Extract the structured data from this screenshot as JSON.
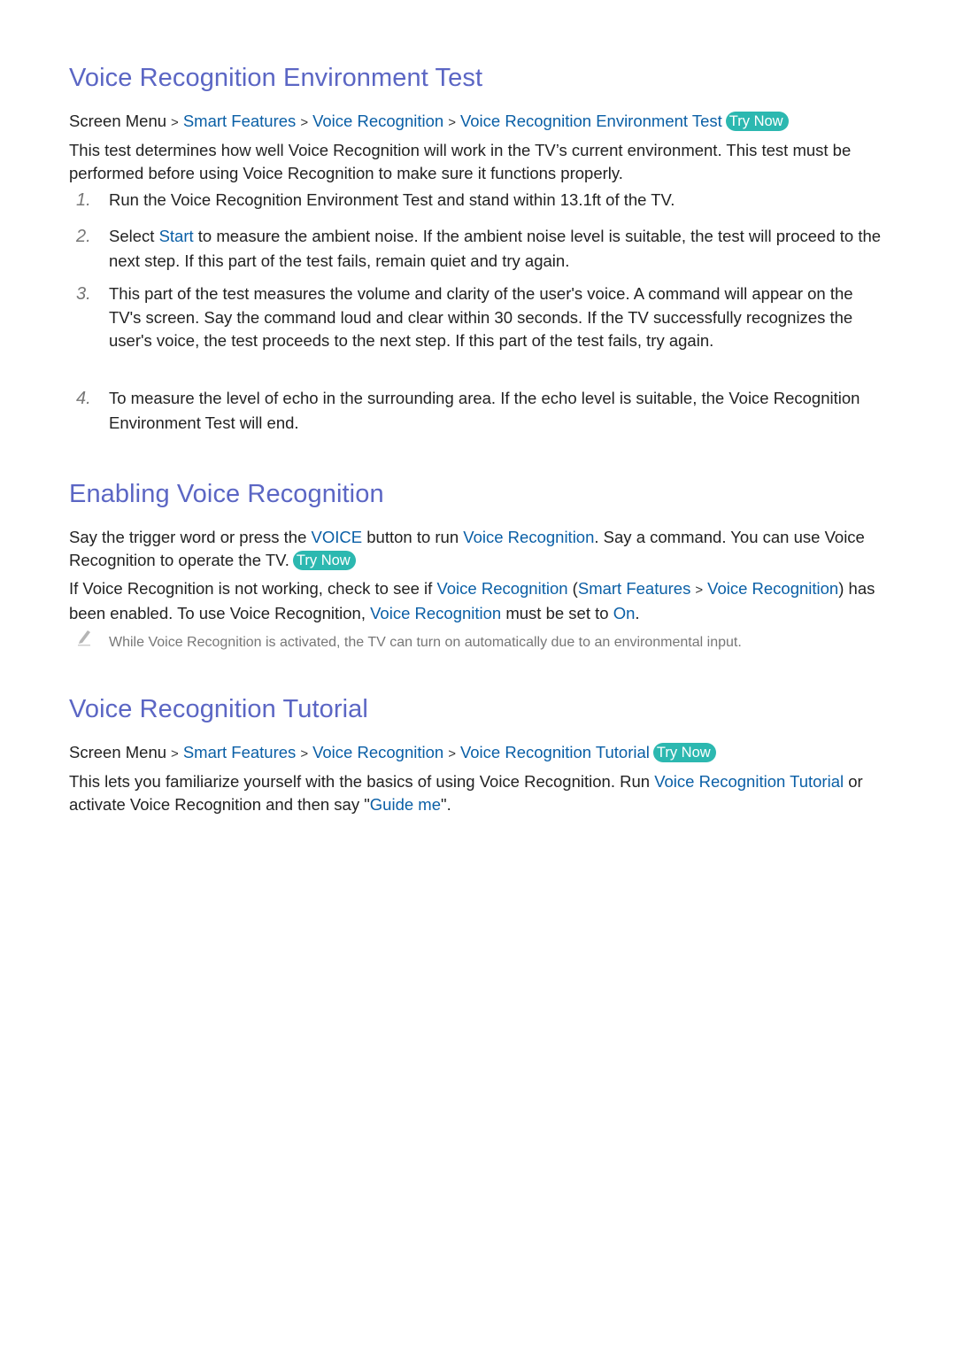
{
  "sections": [
    {
      "title": "Voice Recognition Environment Test",
      "breadcrumb": {
        "root": "Screen Menu",
        "items": [
          "Smart Features",
          "Voice Recognition",
          "Voice Recognition Environment Test"
        ],
        "try_now": "Try Now"
      },
      "intro": "This test determines how well Voice Recognition will work in the TV’s current environment. This test must be performed before using Voice Recognition to make sure it functions properly.",
      "steps": [
        {
          "num": "1.",
          "text": "Run the Voice Recognition Environment Test and stand within 13.1ft of the TV."
        },
        {
          "num": "2.",
          "pre": "Select ",
          "link": "Start",
          "post": " to measure the ambient noise. If the ambient noise level is suitable, the test will proceed to the next step. If this part of the test fails, remain quiet and try again."
        },
        {
          "num": "3.",
          "text": "This part of the test measures the volume and clarity of the user's voice. A command will appear on the TV's screen. Say the command loud and clear within 30 seconds. If the TV successfully recognizes the user's voice, the test proceeds to the next step. If this part of the test fails, try again."
        },
        {
          "num": "4.",
          "text": "To measure the level of echo in the surrounding area. If the echo level is suitable, the Voice Recognition Environment Test will end."
        }
      ]
    },
    {
      "title": "Enabling Voice Recognition",
      "p1": {
        "a": "Say the trigger word or press the ",
        "voice": "VOICE",
        "b": " button to run ",
        "link": "Voice Recognition",
        "c": ". Say a command. You can use Voice Recognition to operate the TV.",
        "try_now": "Try Now"
      },
      "p2": {
        "a": "If Voice Recognition is not working, check to see if ",
        "link1": "Voice Recognition",
        "b": " (",
        "link2": "Smart Features",
        "link3": "Voice Recognition",
        "c": ") has been enabled. To use Voice Recognition, ",
        "link4": "Voice Recognition",
        "d": " must be set to ",
        "link5": "On",
        "e": "."
      },
      "note": "While Voice Recognition is activated, the TV can turn on automatically due to an environmental input."
    },
    {
      "title": "Voice Recognition Tutorial",
      "breadcrumb": {
        "root": "Screen Menu",
        "items": [
          "Smart Features",
          "Voice Recognition",
          "Voice Recognition Tutorial"
        ],
        "try_now": "Try Now"
      },
      "body": {
        "a": "This lets you familiarize yourself with the basics of using Voice Recognition. Run ",
        "link1": "Voice Recognition Tutorial",
        "b": " or activate Voice Recognition and then say \"",
        "link2": "Guide me",
        "c": "\"."
      }
    }
  ],
  "separator": ">",
  "colors": {
    "heading": "#5b66c4",
    "link": "#0a5fa6",
    "try_now": "#2cb8b0",
    "note": "#777777"
  }
}
